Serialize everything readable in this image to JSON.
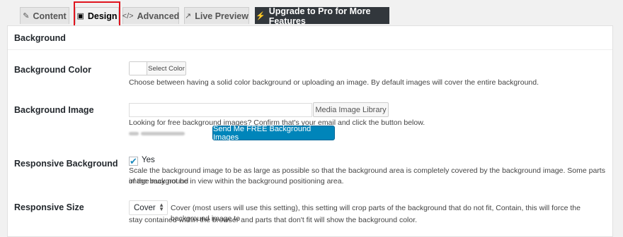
{
  "tabs": [
    {
      "icon": "pencil-square-icon",
      "label": "Content"
    },
    {
      "icon": "image-icon",
      "label": "Design"
    },
    {
      "icon": "code-icon",
      "label": "Advanced"
    },
    {
      "icon": "external-link-icon",
      "label": "Live Preview"
    },
    {
      "icon": "bolt-icon",
      "label": "Upgrade to Pro for More Features"
    }
  ],
  "panel": {
    "title": "Background",
    "background_color": {
      "label": "Background Color",
      "button_label": "Select Color",
      "description": "Choose between having a solid color background or uploading an image. By default images will cover the entire background."
    },
    "background_image": {
      "label": "Background Image",
      "input_value": "",
      "media_button": "Media Image Library",
      "free_text": "Looking for free background images? Confirm that's your email and click the button below.",
      "email_button": "Send Me FREE Background Images"
    },
    "responsive_background": {
      "label": "Responsive Background",
      "checked": true,
      "checkbox_label": "Yes",
      "description_line1": "Scale the background image to be as large as possible so that the background area is completely covered by the background image. Some parts of the background",
      "description_line2": "image may not be in view within the background positioning area."
    },
    "responsive_size": {
      "label": "Responsive Size",
      "selected": "Cover",
      "description_line1": "Cover (most users will use this setting), this setting will crop parts of the background that do not fit, Contain, this will force the background image to",
      "description_line2": "stay contained within the browser and parts that don't fit will show the background color."
    }
  },
  "colors": {
    "primary": "#0085ba",
    "highlight": "#e0141e",
    "upgrade_tab": "#32373c"
  }
}
